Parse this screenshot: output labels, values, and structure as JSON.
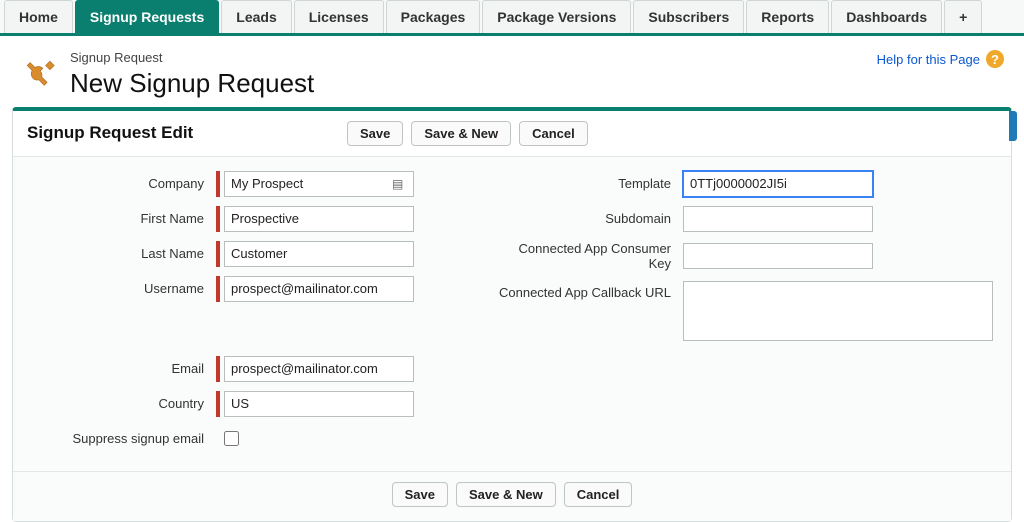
{
  "tabs": {
    "home": "Home",
    "signup_requests": "Signup Requests",
    "leads": "Leads",
    "licenses": "Licenses",
    "packages": "Packages",
    "package_versions": "Package Versions",
    "subscribers": "Subscribers",
    "reports": "Reports",
    "dashboards": "Dashboards",
    "plus": "+"
  },
  "header": {
    "supertitle": "Signup Request",
    "title": "New Signup Request",
    "help_text": "Help for this Page",
    "help_icon_glyph": "?"
  },
  "panel": {
    "title": "Signup Request Edit"
  },
  "buttons": {
    "save": "Save",
    "save_new": "Save & New",
    "cancel": "Cancel"
  },
  "labels": {
    "company": "Company",
    "first_name": "First Name",
    "last_name": "Last Name",
    "username": "Username",
    "email": "Email",
    "country": "Country",
    "suppress": "Suppress signup email",
    "template": "Template",
    "subdomain": "Subdomain",
    "consumer_key": "Connected App Consumer Key",
    "callback_url": "Connected App Callback URL"
  },
  "values": {
    "company": "My Prospect",
    "first_name": "Prospective",
    "last_name": "Customer",
    "username": "prospect@mailinator.com",
    "email": "prospect@mailinator.com",
    "country": "US",
    "template": "0TTj0000002JI5i",
    "subdomain": "",
    "consumer_key": "",
    "callback_url": ""
  }
}
